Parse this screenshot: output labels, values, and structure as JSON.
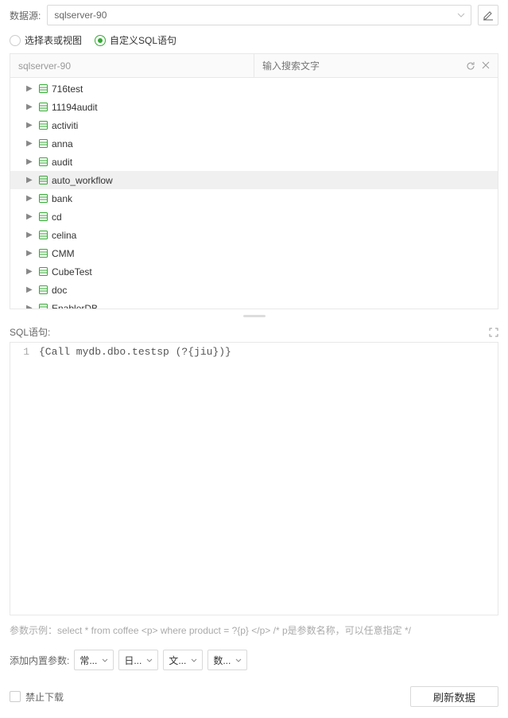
{
  "datasource": {
    "label": "数据源:",
    "value": "sqlserver-90"
  },
  "mode": {
    "option1": "选择表或视图",
    "option2": "自定义SQL语句",
    "selected": "custom"
  },
  "tree": {
    "breadcrumb": "sqlserver-90",
    "search_placeholder": "输入搜索文字",
    "items": [
      {
        "label": "716test"
      },
      {
        "label": "11194audit"
      },
      {
        "label": "activiti"
      },
      {
        "label": "anna"
      },
      {
        "label": "audit"
      },
      {
        "label": "auto_workflow",
        "hover": true
      },
      {
        "label": "bank"
      },
      {
        "label": "cd"
      },
      {
        "label": "celina"
      },
      {
        "label": "CMM"
      },
      {
        "label": "CubeTest"
      },
      {
        "label": "doc"
      },
      {
        "label": "EnablerDB"
      }
    ]
  },
  "sql": {
    "label": "SQL语句:",
    "line_no": "1",
    "code": "{Call mydb.dbo.testsp (?{jiu})}"
  },
  "hint": "参数示例：select * from coffee <p> where product = ?{p} </p>  /* p是参数名称，可以任意指定 */",
  "params": {
    "label": "添加内置参数:",
    "opts": [
      "常...",
      "日...",
      "文...",
      "数..."
    ]
  },
  "footer": {
    "forbid_download": "禁止下载",
    "refresh": "刷新数据"
  }
}
